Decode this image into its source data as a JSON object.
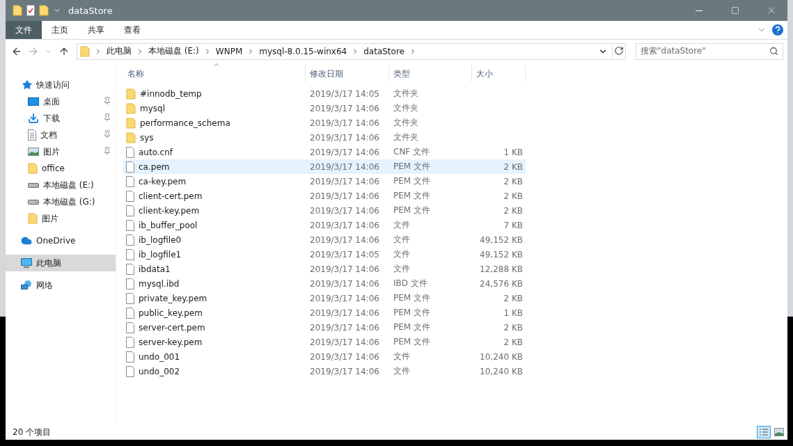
{
  "window": {
    "title": "dataStore"
  },
  "ribbon_tabs": [
    {
      "label": "文件",
      "selected": true
    },
    {
      "label": "主页",
      "selected": false
    },
    {
      "label": "共享",
      "selected": false
    },
    {
      "label": "查看",
      "selected": false
    }
  ],
  "address_bar": {
    "crumbs": [
      "此电脑",
      "本地磁盘 (E:)",
      "WNPM",
      "mysql-8.0.15-winx64",
      "dataStore"
    ]
  },
  "search": {
    "placeholder": "搜索\"dataStore\""
  },
  "sidebar": {
    "items": [
      {
        "label": "快速访问",
        "kind": "star",
        "selected": false,
        "children": [
          {
            "label": "桌面",
            "kind": "desktop",
            "pinned": true,
            "selected": false
          },
          {
            "label": "下载",
            "kind": "download",
            "pinned": true,
            "selected": false
          },
          {
            "label": "文档",
            "kind": "document",
            "pinned": true,
            "selected": false
          },
          {
            "label": "图片",
            "kind": "image",
            "pinned": true,
            "selected": false
          },
          {
            "label": "office",
            "kind": "folder",
            "pinned": false,
            "selected": false
          },
          {
            "label": "本地磁盘 (E:)",
            "kind": "drive",
            "pinned": false,
            "selected": false
          },
          {
            "label": "本地磁盘 (G:)",
            "kind": "drive",
            "pinned": false,
            "selected": false
          },
          {
            "label": "图片",
            "kind": "folder",
            "pinned": false,
            "selected": false
          }
        ]
      },
      {
        "label": "OneDrive",
        "kind": "cloud",
        "selected": false
      },
      {
        "label": "此电脑",
        "kind": "computer",
        "selected": true
      },
      {
        "label": "网络",
        "kind": "network",
        "selected": false
      }
    ]
  },
  "table": {
    "columns": [
      "名称",
      "修改日期",
      "类型",
      "大小"
    ],
    "rows": [
      {
        "name": "#innodb_temp",
        "date": "2019/3/17 14:05",
        "type": "文件夹",
        "kind": "folder",
        "selected": false
      },
      {
        "name": "mysql",
        "date": "2019/3/17 14:06",
        "type": "文件夹",
        "kind": "folder",
        "selected": false
      },
      {
        "name": "performance_schema",
        "date": "2019/3/17 14:06",
        "type": "文件夹",
        "kind": "folder",
        "selected": false
      },
      {
        "name": "sys",
        "date": "2019/3/17 14:06",
        "type": "文件夹",
        "kind": "folder",
        "selected": false
      },
      {
        "name": "auto.cnf",
        "date": "2019/3/17 14:06",
        "type": "CNF 文件",
        "size": "1 KB",
        "kind": "file",
        "selected": false
      },
      {
        "name": "ca.pem",
        "date": "2019/3/17 14:06",
        "type": "PEM 文件",
        "size": "2 KB",
        "kind": "file",
        "selected": true
      },
      {
        "name": "ca-key.pem",
        "date": "2019/3/17 14:06",
        "type": "PEM 文件",
        "size": "2 KB",
        "kind": "file",
        "selected": false
      },
      {
        "name": "client-cert.pem",
        "date": "2019/3/17 14:06",
        "type": "PEM 文件",
        "size": "2 KB",
        "kind": "file",
        "selected": false
      },
      {
        "name": "client-key.pem",
        "date": "2019/3/17 14:06",
        "type": "PEM 文件",
        "size": "2 KB",
        "kind": "file",
        "selected": false
      },
      {
        "name": "ib_buffer_pool",
        "date": "2019/3/17 14:06",
        "type": "文件",
        "size": "7 KB",
        "kind": "file",
        "selected": false
      },
      {
        "name": "ib_logfile0",
        "date": "2019/3/17 14:06",
        "type": "文件",
        "size": "49,152 KB",
        "kind": "file",
        "selected": false
      },
      {
        "name": "ib_logfile1",
        "date": "2019/3/17 14:05",
        "type": "文件",
        "size": "49,152 KB",
        "kind": "file",
        "selected": false
      },
      {
        "name": "ibdata1",
        "date": "2019/3/17 14:06",
        "type": "文件",
        "size": "12,288 KB",
        "kind": "file",
        "selected": false
      },
      {
        "name": "mysql.ibd",
        "date": "2019/3/17 14:06",
        "type": "IBD 文件",
        "size": "24,576 KB",
        "kind": "file",
        "selected": false
      },
      {
        "name": "private_key.pem",
        "date": "2019/3/17 14:06",
        "type": "PEM 文件",
        "size": "2 KB",
        "kind": "file",
        "selected": false
      },
      {
        "name": "public_key.pem",
        "date": "2019/3/17 14:06",
        "type": "PEM 文件",
        "size": "1 KB",
        "kind": "file",
        "selected": false
      },
      {
        "name": "server-cert.pem",
        "date": "2019/3/17 14:06",
        "type": "PEM 文件",
        "size": "2 KB",
        "kind": "file",
        "selected": false
      },
      {
        "name": "server-key.pem",
        "date": "2019/3/17 14:06",
        "type": "PEM 文件",
        "size": "2 KB",
        "kind": "file",
        "selected": false
      },
      {
        "name": "undo_001",
        "date": "2019/3/17 14:06",
        "type": "文件",
        "size": "10,240 KB",
        "kind": "file",
        "selected": false
      },
      {
        "name": "undo_002",
        "date": "2019/3/17 14:06",
        "type": "文件",
        "size": "10,240 KB",
        "kind": "file",
        "selected": false
      }
    ]
  },
  "status_bar": {
    "count": "20 个项目",
    "views": [
      {
        "kind": "details",
        "selected": true
      },
      {
        "kind": "thumbnails",
        "selected": false
      }
    ]
  }
}
